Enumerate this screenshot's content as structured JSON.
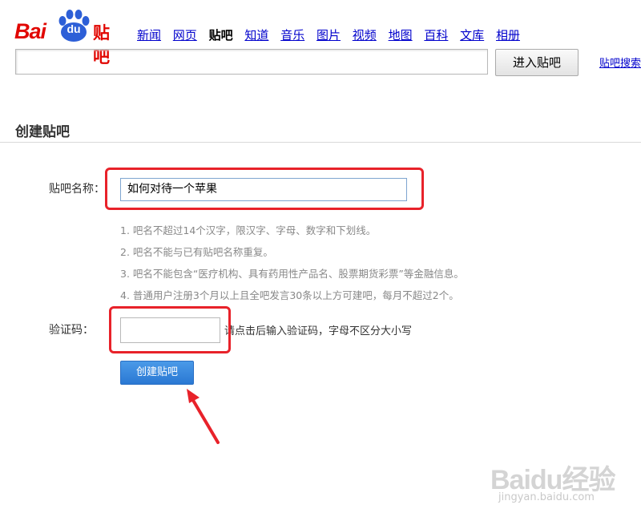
{
  "brand": {
    "logo_bai": "Bai",
    "logo_du": "du",
    "logo_tieba": "贴吧",
    "color": "#e10601"
  },
  "nav": {
    "items": [
      "新闻",
      "网页",
      "贴吧",
      "知道",
      "音乐",
      "图片",
      "视频",
      "地图",
      "百科",
      "文库",
      "相册"
    ],
    "current": "贴吧"
  },
  "search": {
    "value": "",
    "button_label": "进入贴吧",
    "help_link": "贴吧搜索"
  },
  "page": {
    "title": "创建贴吧"
  },
  "form": {
    "name_label": "贴吧名称：",
    "name_value": "如何对待一个苹果",
    "rules": [
      "1. 吧名不超过14个汉字，限汉字、字母、数字和下划线。",
      "2. 吧名不能与已有贴吧名称重复。",
      "3. 吧名不能包含“医疗机构、具有药用性产品名、股票期货彩票”等金融信息。",
      "4. 普通用户注册3个月以上且全吧发言30条以上方可建吧，每月不超过2个。"
    ],
    "captcha_label": "验证码：",
    "captcha_value": "",
    "captcha_hint": "请点击后输入验证码，字母不区分大小写",
    "submit_label": "创建贴吧"
  },
  "annotations": {
    "highlight_color": "#e8222a",
    "icon": "red-arrow-icon"
  },
  "watermark": {
    "main": "Baidu经验",
    "url": "jingyan.baidu.com"
  }
}
